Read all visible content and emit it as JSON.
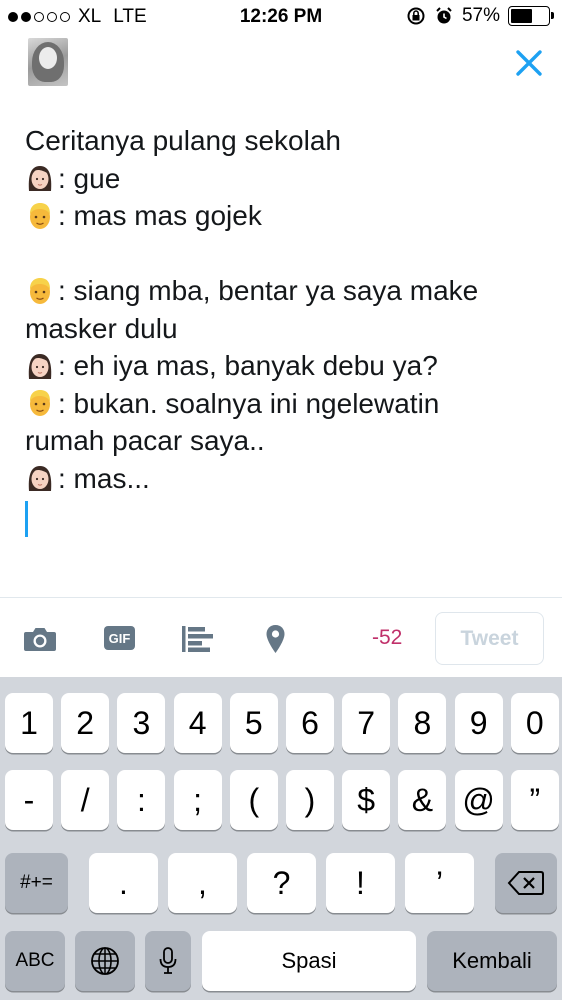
{
  "status_bar": {
    "signal_bars_filled": 2,
    "signal_bars_total": 5,
    "carrier": "XL",
    "network": "LTE",
    "time": "12:26 PM",
    "battery_text": "57%",
    "battery_level": 0.57
  },
  "compose": {
    "lines": [
      {
        "emoji": null,
        "text": "Ceritanya pulang sekolah"
      },
      {
        "emoji": "woman-emoji",
        "text": ": gue"
      },
      {
        "emoji": "man-blond-emoji",
        "text": ": mas mas gojek"
      },
      {
        "emoji": null,
        "text": ""
      },
      {
        "emoji": "man-blond-emoji",
        "text": ": siang mba, bentar ya saya make"
      },
      {
        "emoji": null,
        "text": "masker dulu"
      },
      {
        "emoji": "woman-emoji",
        "text": ": eh iya mas, banyak debu ya?"
      },
      {
        "emoji": "man-blond-emoji",
        "text": ": bukan. soalnya ini ngelewatin"
      },
      {
        "emoji": null,
        "text": "rumah pacar saya.."
      },
      {
        "emoji": "woman-emoji",
        "text": ": mas..."
      }
    ]
  },
  "toolbar": {
    "camera_icon": "camera-icon",
    "gif_label": "GIF",
    "poll_icon": "poll-icon",
    "location_icon": "location-pin-icon",
    "char_counter": "-52",
    "tweet_label": "Tweet"
  },
  "keyboard": {
    "row1": [
      "1",
      "2",
      "3",
      "4",
      "5",
      "6",
      "7",
      "8",
      "9",
      "0"
    ],
    "row2": [
      "-",
      "/",
      ":",
      ";",
      "(",
      ")",
      "$",
      "&",
      "@",
      "”"
    ],
    "row3_switch": "#+=",
    "row3": [
      ".",
      ",",
      "?",
      "!",
      "’"
    ],
    "backspace_icon": "backspace-icon",
    "abc": "ABC",
    "globe_icon": "globe-icon",
    "mic_icon": "microphone-icon",
    "space": "Spasi",
    "return": "Kembali"
  },
  "colors": {
    "accent": "#1da1f2",
    "counter_over": "#c0306a",
    "keyboard_bg": "#d2d6dc"
  }
}
